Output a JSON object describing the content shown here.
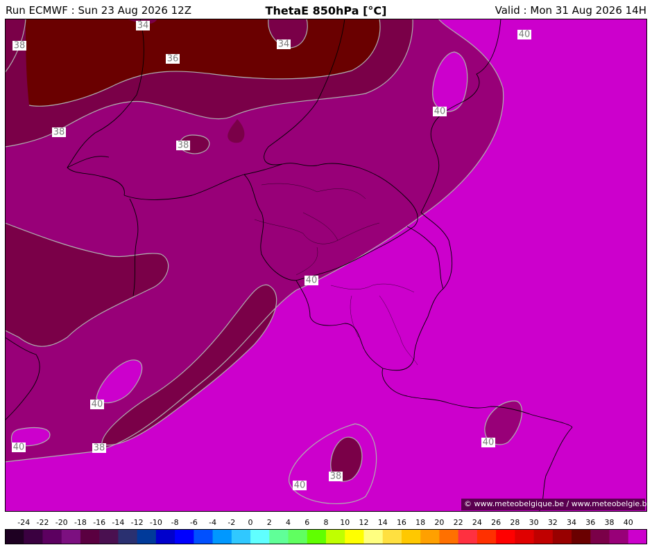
{
  "header": {
    "run": "Run ECMWF : Sun 23 Aug 2026 12Z",
    "title": "ThetaE 850hPa [°C]",
    "valid": "Valid : Mon 31 Aug 2026 14H"
  },
  "copyright": "© www.meteobelgique.be / www.meteobelgie.be",
  "colors": {
    "level_34": "#6a0000",
    "level_36": "#7a0048",
    "level_38": "#980078",
    "level_40": "#cc00cc",
    "contour": "#b0b0b0",
    "border": "#000000"
  },
  "contour_labels": [
    "38",
    "34",
    "34",
    "36",
    "40",
    "40",
    "38",
    "38",
    "40",
    "40",
    "40",
    "38",
    "40",
    "38",
    "40"
  ],
  "legend": {
    "ticks": [
      "-24",
      "-22",
      "-20",
      "-18",
      "-16",
      "-14",
      "-12",
      "-10",
      "-8",
      "-6",
      "-4",
      "-2",
      "0",
      "2",
      "4",
      "6",
      "8",
      "10",
      "12",
      "14",
      "16",
      "18",
      "20",
      "22",
      "24",
      "26",
      "28",
      "30",
      "32",
      "34",
      "36",
      "38",
      "40"
    ],
    "colors": [
      "#1e0022",
      "#3a0040",
      "#5c0060",
      "#7c1080",
      "#5a0040",
      "#4a1050",
      "#2a3070",
      "#003a9a",
      "#0000cc",
      "#0000ff",
      "#0050ff",
      "#0098ff",
      "#30c8ff",
      "#60ffff",
      "#60ff98",
      "#60ff60",
      "#60ff00",
      "#c0ff00",
      "#ffff00",
      "#ffff80",
      "#ffe040",
      "#ffc800",
      "#ffa000",
      "#ff7000",
      "#ff3040",
      "#ff3000",
      "#ff0000",
      "#e00000",
      "#c00000",
      "#980000",
      "#6a0000",
      "#7a0048",
      "#980078",
      "#cc00cc"
    ]
  }
}
